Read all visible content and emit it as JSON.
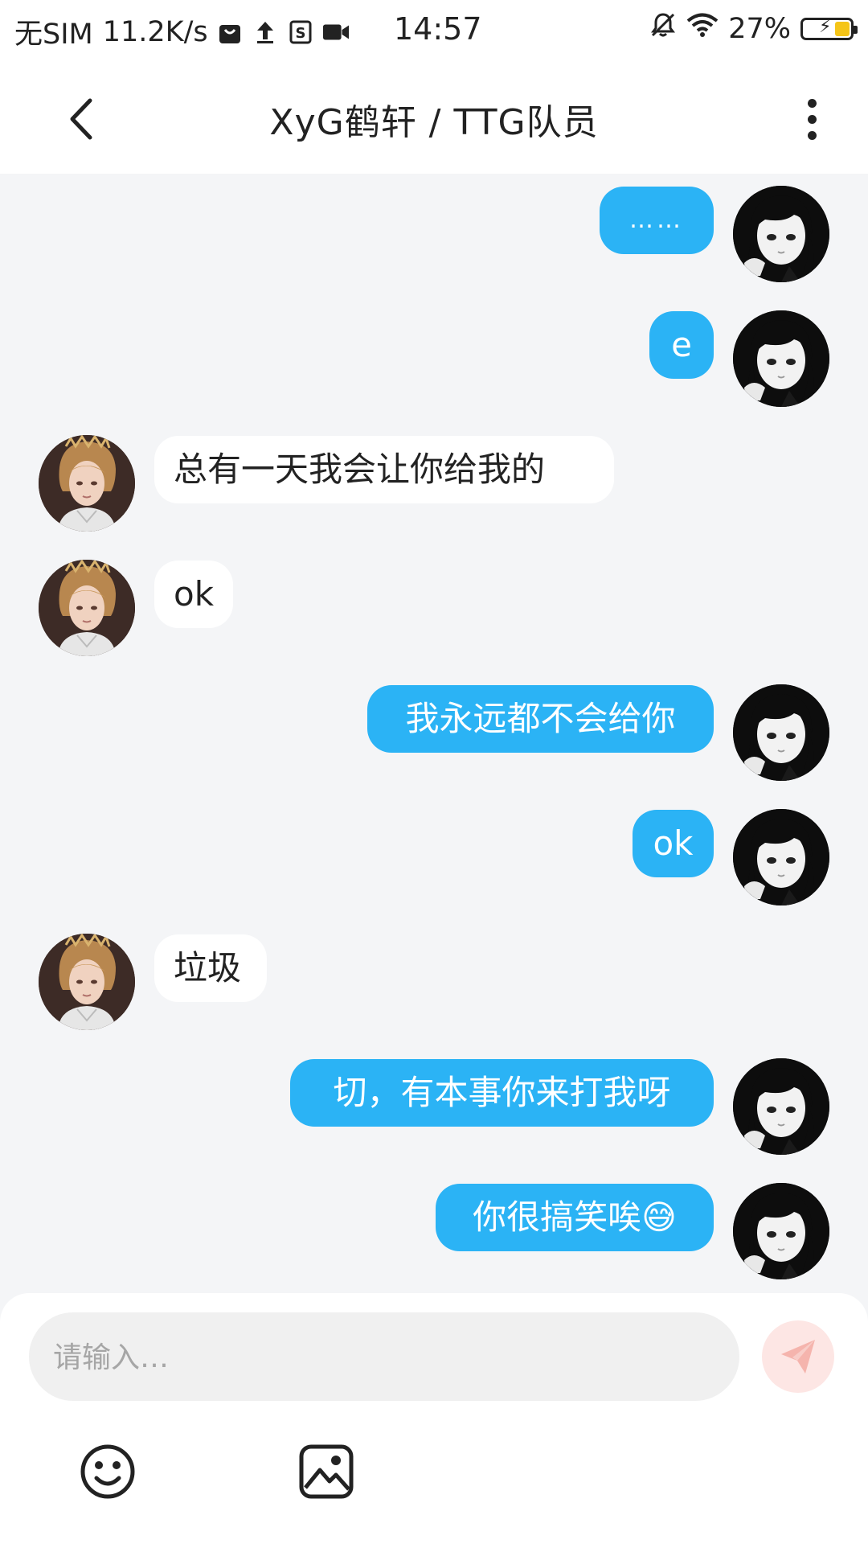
{
  "status_bar": {
    "carrier": "无SIM",
    "speed": "11.2K/s",
    "time": "14:57",
    "battery": "27%"
  },
  "header": {
    "title": "XyG鹤轩 / TTG队员"
  },
  "messages": [
    {
      "sender": "me",
      "text": "……"
    },
    {
      "sender": "me",
      "text": "e"
    },
    {
      "sender": "other",
      "text": "总有一天我会让你给我的"
    },
    {
      "sender": "other",
      "text": "ok"
    },
    {
      "sender": "me",
      "text": "我永远都不会给你"
    },
    {
      "sender": "me",
      "text": "ok"
    },
    {
      "sender": "other",
      "text": "垃圾"
    },
    {
      "sender": "me",
      "text": "切，有本事你来打我呀"
    },
    {
      "sender": "me",
      "text": "你很搞笑唉😅"
    }
  ],
  "input": {
    "placeholder": "请输入…",
    "value": ""
  },
  "colors": {
    "my_bubble": "#2bb3f5",
    "other_bubble": "#ffffff",
    "send_button": "#fde6e4",
    "send_icon": "#f5b4ad"
  },
  "icons": {
    "back": "back-arrow-icon",
    "more": "more-vertical-icon",
    "send": "paper-plane-icon",
    "emoji": "smiley-icon",
    "image": "image-icon"
  }
}
